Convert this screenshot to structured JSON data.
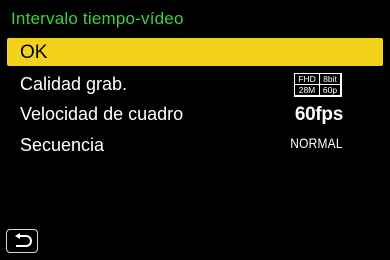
{
  "title": "Intervalo tiempo-vídeo",
  "menu": {
    "ok_label": "OK",
    "items": [
      {
        "label": "Calidad grab.",
        "badge": [
          "FHD",
          "8bit",
          "28M",
          "60p"
        ]
      },
      {
        "label": "Velocidad de cuadro",
        "value": "60fps"
      },
      {
        "label": "Secuencia",
        "value": "NORMAL"
      }
    ]
  },
  "footer": {
    "back_icon": "return-arrow-icon"
  },
  "colors": {
    "title": "#3fcf3f",
    "highlight": "#f2d21a",
    "background": "#000000"
  }
}
